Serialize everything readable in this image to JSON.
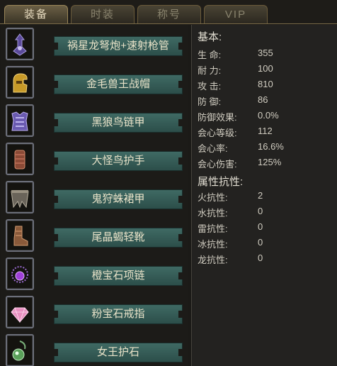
{
  "tabs": [
    {
      "label": "装备",
      "active": true
    },
    {
      "label": "时装",
      "active": false
    },
    {
      "label": "称号",
      "active": false
    },
    {
      "label": "VIP",
      "active": false
    }
  ],
  "equipment": [
    {
      "name": "祸星龙弩炮+速射枪管",
      "icon": "crossbow-icon"
    },
    {
      "name": "金毛兽王战帽",
      "icon": "helmet-icon"
    },
    {
      "name": "黑狼鸟链甲",
      "icon": "chestplate-icon"
    },
    {
      "name": "大怪鸟护手",
      "icon": "gauntlet-icon"
    },
    {
      "name": "鬼狩蛛裙甲",
      "icon": "waist-armor-icon"
    },
    {
      "name": "尾晶蝎轻靴",
      "icon": "boots-icon"
    },
    {
      "name": "橙宝石项链",
      "icon": "necklace-icon"
    },
    {
      "name": "粉宝石戒指",
      "icon": "ring-icon"
    },
    {
      "name": "女王护石",
      "icon": "talisman-icon"
    }
  ],
  "stats": {
    "basic_title": "基本:",
    "basic": [
      {
        "label": "生 命:",
        "value": "355"
      },
      {
        "label": "耐 力:",
        "value": "100"
      },
      {
        "label": "攻 击:",
        "value": "810"
      },
      {
        "label": "防 御:",
        "value": "86"
      },
      {
        "label": "防御效果:",
        "value": "0.0%"
      },
      {
        "label": "会心等级:",
        "value": "112"
      },
      {
        "label": "会心率:",
        "value": "16.6%"
      },
      {
        "label": "会心伤害:",
        "value": "125%"
      }
    ],
    "resist_title": "属性抗性:",
    "resist": [
      {
        "label": "火抗性:",
        "value": "2"
      },
      {
        "label": "水抗性:",
        "value": "0"
      },
      {
        "label": "雷抗性:",
        "value": "0"
      },
      {
        "label": "冰抗性:",
        "value": "0"
      },
      {
        "label": "龙抗性:",
        "value": "0"
      }
    ]
  },
  "colors": {
    "namebar": "#3f6a64",
    "panel": "#232220",
    "tab_active": "#6a5f45"
  }
}
